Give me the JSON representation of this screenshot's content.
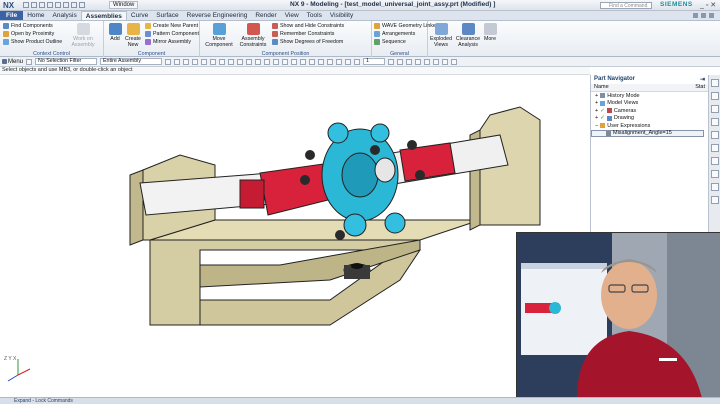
{
  "titlebar": {
    "logo": "NX",
    "window_menu": "Window",
    "title": "NX 9 - Modeling - [test_model_universal_joint_assy.prt (Modified) ]",
    "command_search_placeholder": "Find a Command",
    "brand": "SIEMENS",
    "window_controls": "_ ▫ ✕"
  },
  "menu": {
    "tabs": [
      "File",
      "Home",
      "Analysis",
      "Assemblies",
      "Curve",
      "Surface",
      "Reverse Engineering",
      "Render",
      "View",
      "Tools",
      "Visibility"
    ],
    "active": "Assemblies"
  },
  "ribbon": {
    "context_control": {
      "label": "Context Control",
      "items": [
        "Find Components",
        "Open by Proximity",
        "Show Product Outline"
      ],
      "work_on_assembly": "Work on Assembly"
    },
    "component": {
      "label": "Component",
      "add": "Add",
      "create_new": "Create New",
      "items": [
        "Create New Parent",
        "Pattern Component",
        "Mirror Assembly"
      ]
    },
    "component_position": {
      "label": "Component Position",
      "move": "Move Component",
      "assembly_constraints": "Assembly Constraints",
      "items": [
        "Show and Hide Constraints",
        "Remember Constraints",
        "Show Degrees of Freedom"
      ]
    },
    "general": {
      "label": "General",
      "items": [
        "WAVE Geometry Linker",
        "Arrangements",
        "Sequence"
      ]
    },
    "exploded_views": "Exploded Views",
    "clearance_analysis": "Clearance Analysis",
    "more": "More"
  },
  "selection_bar": {
    "menu": "Menu",
    "filter": "No Selection Filter",
    "scope": "Entire Assembly",
    "layer": "1"
  },
  "status_line": "Select objects and use MB3, or double-click an object",
  "navigator": {
    "title": "Part Navigator",
    "col_name": "Name",
    "col_status": "Stat",
    "nodes": [
      "History Mode",
      "Model Views",
      "Cameras",
      "Drawing",
      "User Expressions"
    ],
    "expression": "Misalignment_Angle=15"
  },
  "viewport": {
    "triad": "Z Y X"
  },
  "bottom": {
    "text": "Expand - Lock Commands"
  },
  "colors": {
    "accent": "#3a63a6",
    "model_red": "#d8213a",
    "model_cyan": "#27b5d4",
    "frame_tan": "#cfc79b",
    "shaft": "#ececec"
  }
}
